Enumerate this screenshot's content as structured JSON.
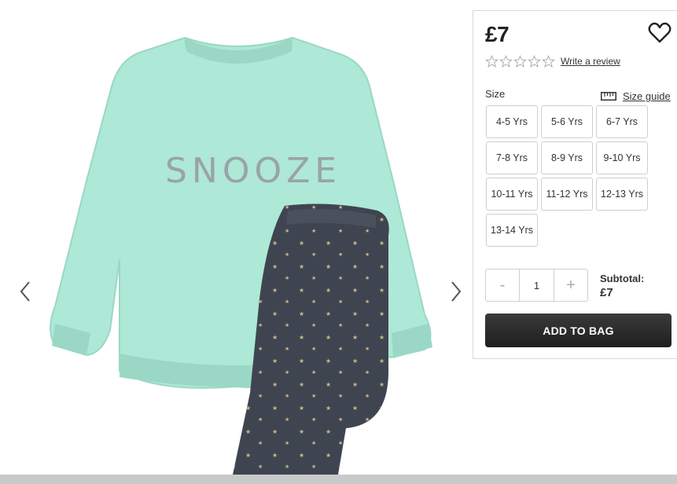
{
  "product": {
    "price": "£7",
    "graphic_text": "SNOOZE"
  },
  "rating": {
    "stars": 0,
    "max_stars": 5,
    "write_review_label": "Write a review"
  },
  "size": {
    "label": "Size",
    "guide_label": "Size guide",
    "options": [
      "4-5 Yrs",
      "5-6 Yrs",
      "6-7 Yrs",
      "7-8 Yrs",
      "8-9 Yrs",
      "9-10 Yrs",
      "10-11 Yrs",
      "11-12 Yrs",
      "12-13 Yrs",
      "13-14 Yrs"
    ]
  },
  "quantity": {
    "minus": "-",
    "value": "1",
    "plus": "+"
  },
  "subtotal": {
    "label": "Subtotal:",
    "amount": "£7"
  },
  "add_to_bag_label": "ADD TO BAG",
  "icons": {
    "prev": "chevron-left-icon",
    "next": "chevron-right-icon",
    "wishlist": "heart-icon",
    "size_guide": "ruler-icon",
    "star": "star-outline-icon"
  },
  "colors": {
    "sweater": "#aee8d6",
    "pants": "#3f4550",
    "button_bg": "#2a2a2a"
  }
}
